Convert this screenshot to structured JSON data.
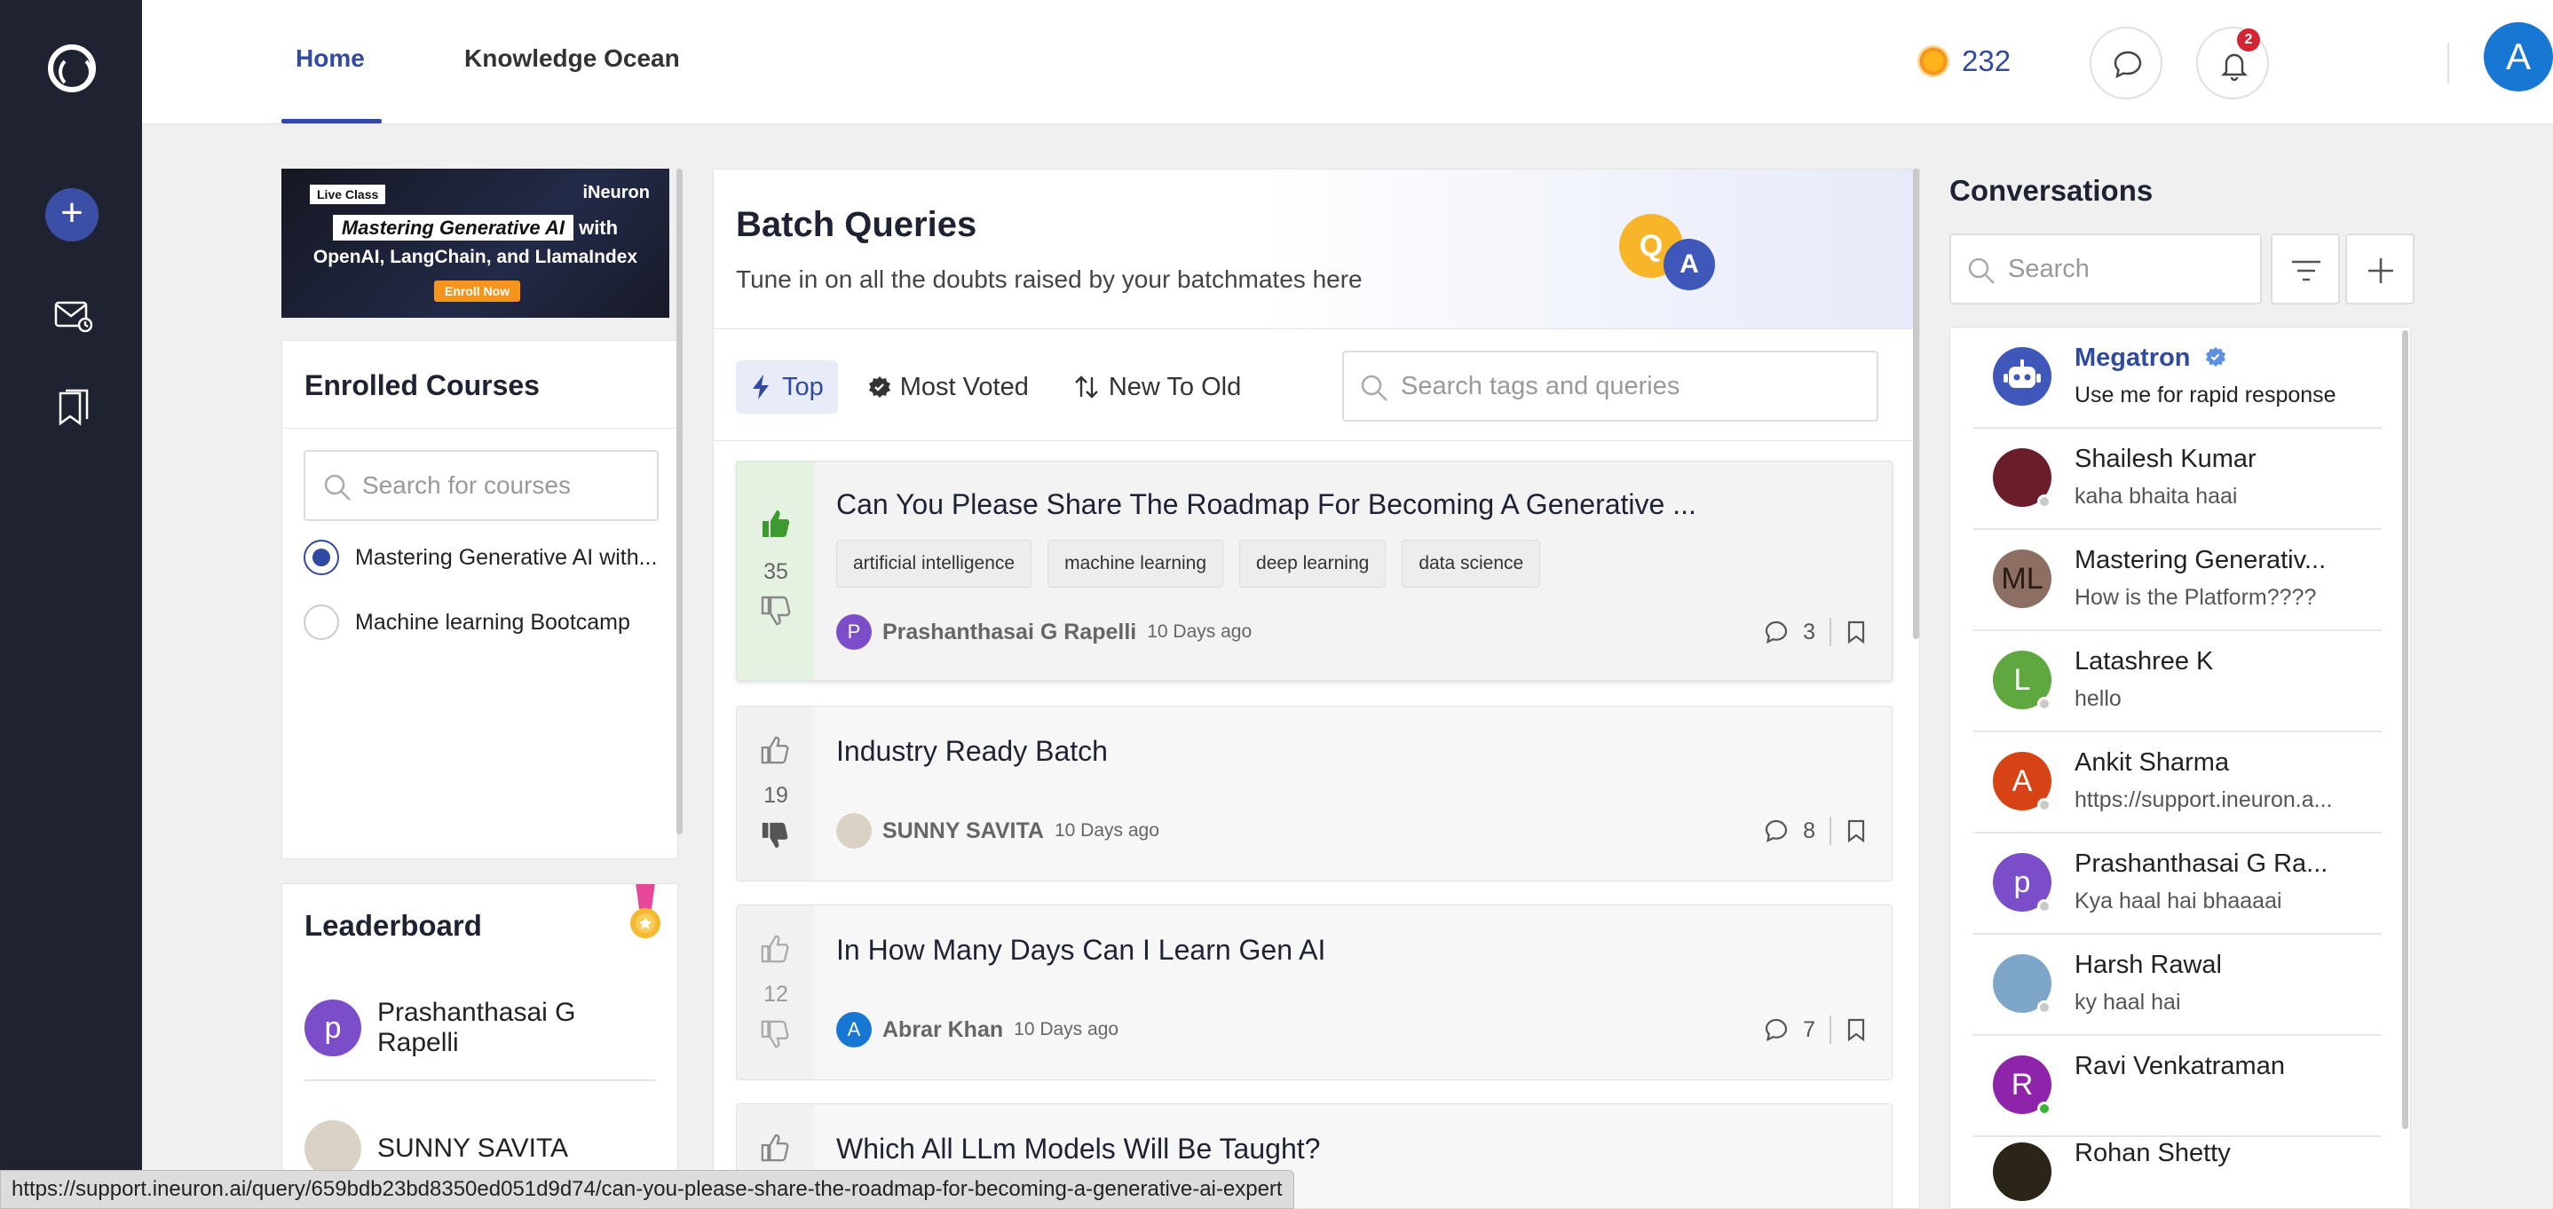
{
  "nav": {
    "tabs": [
      {
        "label": "Home"
      },
      {
        "label": "Knowledge Ocean"
      }
    ],
    "coins": "232",
    "notification_count": "2",
    "user_initial": "A"
  },
  "banner": {
    "live_label": "Live Class",
    "brand": "iNeuron",
    "line1_highlight": "Mastering Generative AI",
    "line1_rest": "with",
    "line2": "OpenAI, LangChain, and LlamaIndex",
    "cta": "Enroll Now"
  },
  "enrolled": {
    "title": "Enrolled Courses",
    "search_placeholder": "Search for courses",
    "courses": [
      {
        "label": "Mastering Generative AI with...",
        "selected": true
      },
      {
        "label": "Machine learning Bootcamp",
        "selected": false
      }
    ]
  },
  "leaderboard": {
    "title": "Leaderboard",
    "entries": [
      {
        "initial": "p",
        "name_line1": "Prashanthasai G",
        "name_line2": "Rapelli"
      },
      {
        "initial": "",
        "name_line1": "SUNNY SAVITA",
        "name_line2": ""
      }
    ]
  },
  "queries": {
    "title": "Batch Queries",
    "subtitle": "Tune in on all the doubts raised by your batchmates here",
    "badge_q": "Q",
    "badge_a": "A",
    "filters": [
      {
        "label": "Top",
        "active": true
      },
      {
        "label": "Most Voted",
        "active": false
      },
      {
        "label": "New To Old",
        "active": false
      }
    ],
    "search_placeholder": "Search tags and queries",
    "items": [
      {
        "title": "Can You Please Share The Roadmap For Becoming A Generative ...",
        "votes": "35",
        "tags": [
          "artificial intelligence",
          "machine learning",
          "deep learning",
          "data science"
        ],
        "author": "Prashanthasai G Rapelli",
        "author_initial": "P",
        "time": "10 Days ago",
        "comments": "3"
      },
      {
        "title": "Industry Ready Batch",
        "votes": "19",
        "tags": [],
        "author": "SUNNY SAVITA",
        "author_initial": "",
        "time": "10 Days ago",
        "comments": "8"
      },
      {
        "title": "In How Many Days Can I Learn Gen AI",
        "votes": "12",
        "tags": [],
        "author": "Abrar Khan",
        "author_initial": "A",
        "time": "10 Days ago",
        "comments": "7"
      },
      {
        "title": "Which All LLm Models Will Be Taught?",
        "votes": "",
        "tags": [],
        "author": "",
        "author_initial": "",
        "time": "",
        "comments": ""
      }
    ]
  },
  "conversations": {
    "title": "Conversations",
    "search_placeholder": "Search",
    "items": [
      {
        "name": "Megatron",
        "message": "Use me for rapid response",
        "initial": "",
        "color": "#3f57b8"
      },
      {
        "name": "Shailesh Kumar",
        "message": "kaha bhaita haai",
        "initial": "",
        "color": "#6b1d2a"
      },
      {
        "name": "Mastering Generativ...",
        "message": "How is the Platform????",
        "initial": "ML",
        "color": "#8d6e63"
      },
      {
        "name": "Latashree K",
        "message": "hello",
        "initial": "L",
        "color": "#5fa83f"
      },
      {
        "name": "Ankit Sharma",
        "message": "https://support.ineuron.a...",
        "initial": "A",
        "color": "#d84315"
      },
      {
        "name": "Prashanthasai G Ra...",
        "message": "Kya haal hai bhaaaai",
        "initial": "p",
        "color": "#7c4dc9"
      },
      {
        "name": "Harsh Rawal",
        "message": "ky haal hai",
        "initial": "",
        "color": "#7ea6c9"
      },
      {
        "name": "Ravi Venkatraman",
        "message": "",
        "initial": "R",
        "color": "#8e24aa"
      },
      {
        "name": "Rohan Shetty",
        "message": "",
        "initial": "",
        "color": "#2b2418"
      }
    ]
  },
  "status_url": "https://support.ineuron.ai/query/659bdb23bd8350ed051d9d74/can-you-please-share-the-roadmap-for-becoming-a-generative-ai-expert"
}
